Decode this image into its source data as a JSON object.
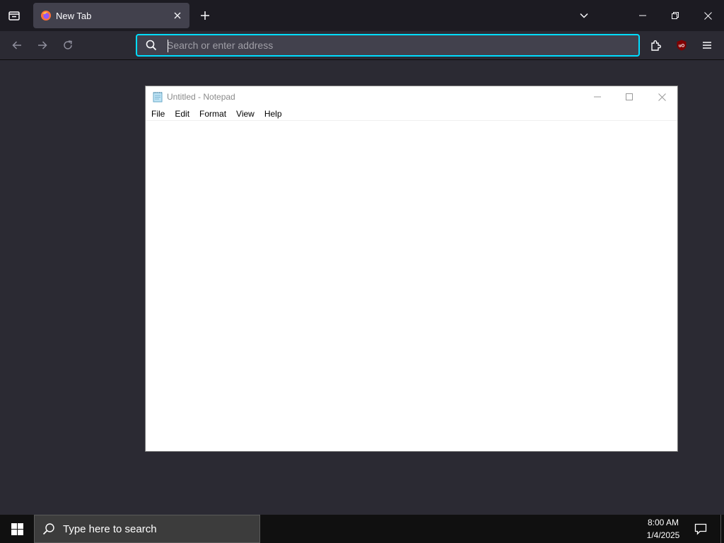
{
  "browser": {
    "tab": {
      "title": "New Tab",
      "close_label": "×"
    },
    "urlbar": {
      "placeholder": "Search or enter address",
      "value": ""
    },
    "colors": {
      "accent": "#00ddff",
      "toolbar": "#2b2a33",
      "tabstrip": "#1c1b22",
      "ublock": "#800000"
    },
    "icons": {
      "tab_list": "tab-list-icon",
      "new_tab": "plus-icon",
      "list_all_tabs": "chevron-down-icon",
      "back": "back-arrow-icon",
      "forward": "forward-arrow-icon",
      "reload": "reload-icon",
      "search": "search-icon",
      "extensions": "puzzle-piece-icon",
      "ublock": "ublock-origin-icon",
      "menu": "hamburger-menu-icon"
    }
  },
  "notepad": {
    "title": "Untitled - Notepad",
    "menu": [
      "File",
      "Edit",
      "Format",
      "View",
      "Help"
    ],
    "content": ""
  },
  "taskbar": {
    "search_placeholder": "Type here to search",
    "time": "8:00 AM",
    "date": "1/4/2025"
  }
}
